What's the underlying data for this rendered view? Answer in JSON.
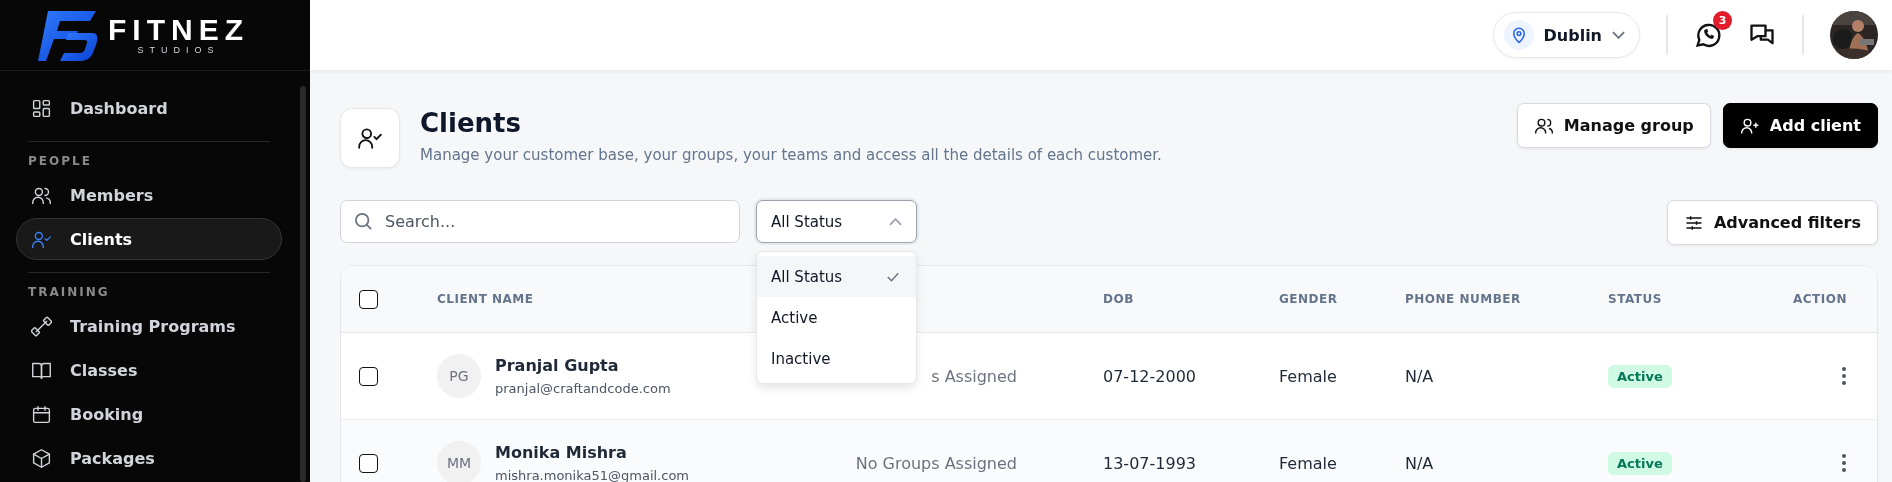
{
  "brand": {
    "name": "FITNEZ",
    "tagline": "STUDIOS"
  },
  "sidebar": {
    "groups": [
      {
        "items": [
          {
            "label": "Dashboard",
            "selected": false
          }
        ]
      },
      {
        "heading": "PEOPLE",
        "items": [
          {
            "label": "Members",
            "selected": false
          },
          {
            "label": "Clients",
            "selected": true
          }
        ]
      },
      {
        "heading": "TRAINING",
        "items": [
          {
            "label": "Training Programs",
            "selected": false
          },
          {
            "label": "Classes",
            "selected": false
          },
          {
            "label": "Booking",
            "selected": false
          },
          {
            "label": "Packages",
            "selected": false
          }
        ]
      }
    ]
  },
  "header": {
    "location": "Dublin",
    "whatsapp_badge": "3"
  },
  "page": {
    "title": "Clients",
    "subtitle": "Manage your customer base, your groups, your teams and access all the details of each customer.",
    "manage_button": "Manage group",
    "add_button": "Add client"
  },
  "filters": {
    "search": {
      "placeholder": "Search..."
    },
    "status": {
      "value": "All Status",
      "expanded": true,
      "options": [
        {
          "label": "All Status",
          "selected": true
        },
        {
          "label": "Active",
          "selected": false
        },
        {
          "label": "Inactive",
          "selected": false
        }
      ]
    },
    "advanced_button": "Advanced filters"
  },
  "table": {
    "select_all_checked": false,
    "columns": [
      "CLIENT NAME",
      "DOB",
      "GENDER",
      "PHONE NUMBER",
      "STATUS",
      "ACTION"
    ],
    "rows": [
      {
        "checked": false,
        "initials": "PG",
        "name": "Pranjal Gupta",
        "email": "pranjal@craftandcode.com",
        "groups": "s Assigned",
        "dob": "07-12-2000",
        "gender": "Female",
        "phone": "N/A",
        "status": "Active"
      },
      {
        "checked": false,
        "initials": "MM",
        "name": "Monika Mishra",
        "email": "mishra.monika51@gmail.com",
        "groups": "No Groups Assigned",
        "dob": "13-07-1993",
        "gender": "Female",
        "phone": "N/A",
        "status": "Active"
      }
    ]
  }
}
